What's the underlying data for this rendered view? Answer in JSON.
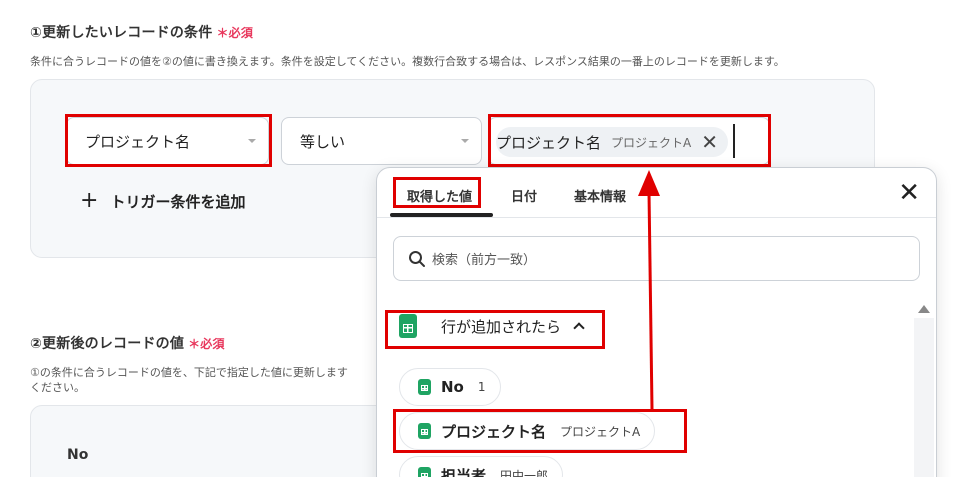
{
  "section1": {
    "title": "①更新したいレコードの条件",
    "required": "＊必須",
    "description": "条件に合うレコードの値を②の値に書き換えます。条件を設定してください。複数行合致する場合は、レスポンス結果の一番上のレコードを更新します。"
  },
  "condition": {
    "field_select": "プロジェクト名",
    "operator_select": "等しい",
    "value_chip": {
      "label": "プロジェクト名",
      "value": "プロジェクトA",
      "remove": "✕"
    },
    "add_trigger": {
      "icon": "+",
      "label": "トリガー条件を追加"
    }
  },
  "section2": {
    "title": "②更新後のレコードの値",
    "required": "＊必須",
    "description_line1": "①の条件に合うレコードの値を、下記で指定した値に更新します",
    "description_line2": "ください。",
    "field_label": "No"
  },
  "popup": {
    "tabs": [
      "取得した値",
      "日付",
      "基本情報"
    ],
    "close": "✕",
    "search_placeholder": "検索（前方一致）",
    "group": {
      "label": "行が追加されたら",
      "icon": "google-sheets-icon"
    },
    "items": [
      {
        "name": "No",
        "value": "1"
      },
      {
        "name": "プロジェクト名",
        "value": "プロジェクトA"
      },
      {
        "name": "担当者",
        "value": "田中一郎"
      }
    ]
  },
  "colors": {
    "annotation_red": "#e00000",
    "required_pink": "#e8385d",
    "sheets_green": "#1fa463"
  }
}
